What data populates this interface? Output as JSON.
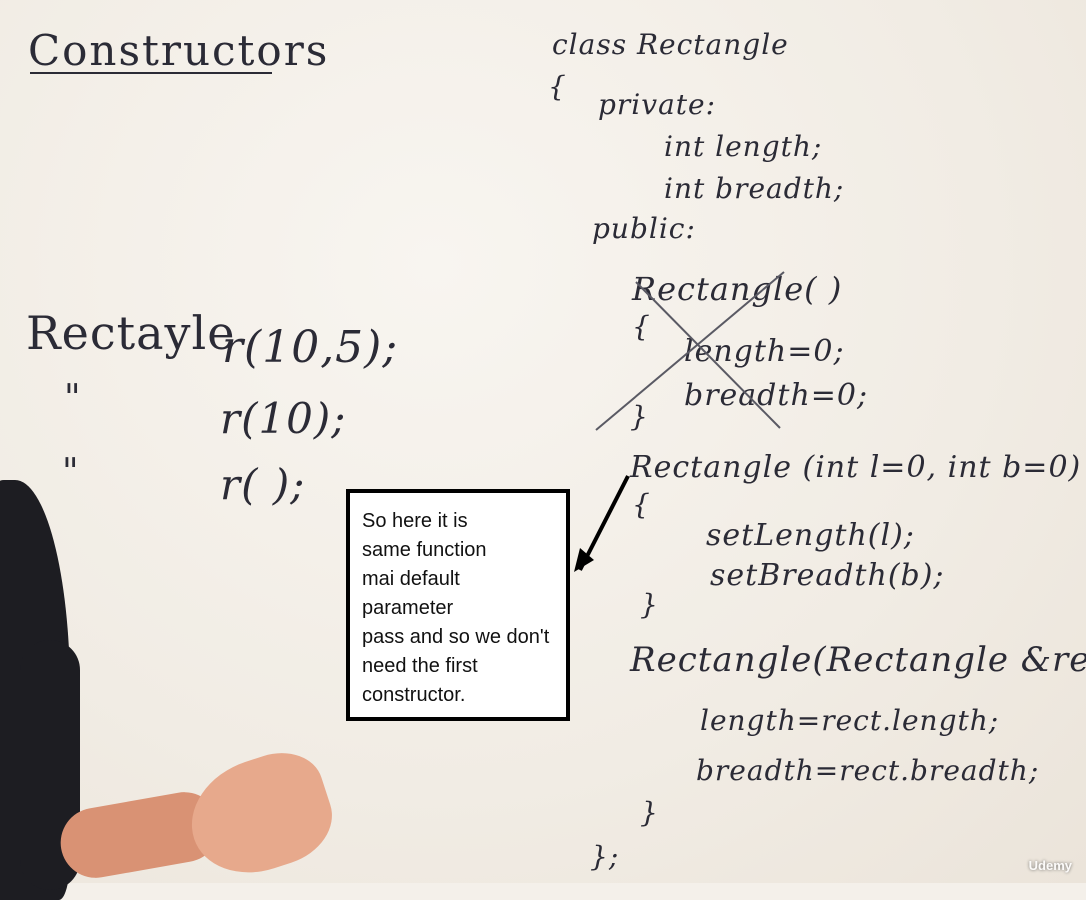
{
  "board": {
    "title": "Constructors",
    "left": {
      "rect_word": "Rectayle",
      "call1": "r(10,5);",
      "ditto1": "\"",
      "call2": "r(10);",
      "ditto2": "\"",
      "call3": "r( );"
    },
    "code": [
      "class Rectangle",
      "{",
      "private:",
      "int length;",
      "int breadth;",
      "public:",
      "Rectangle(  )",
      "{",
      "length=0;",
      "breadth=0;",
      "}",
      "Rectangle (int l=0, int b=0)",
      "{",
      "setLength(l);",
      "setBreadth(b);",
      "}",
      "Rectangle(Rectangle &rect)",
      "length=rect.length;",
      "breadth=rect.breadth;",
      "}",
      "};"
    ]
  },
  "callout": {
    "lines": [
      "So here it is",
      "same function",
      "mai default",
      "parameter",
      "pass and so we don't",
      "need the first",
      "constructor."
    ]
  },
  "watermark": "Udemy",
  "colors": {
    "ink": "#2b2b36",
    "board": "#f4f0ea",
    "callout_border": "#000000"
  }
}
